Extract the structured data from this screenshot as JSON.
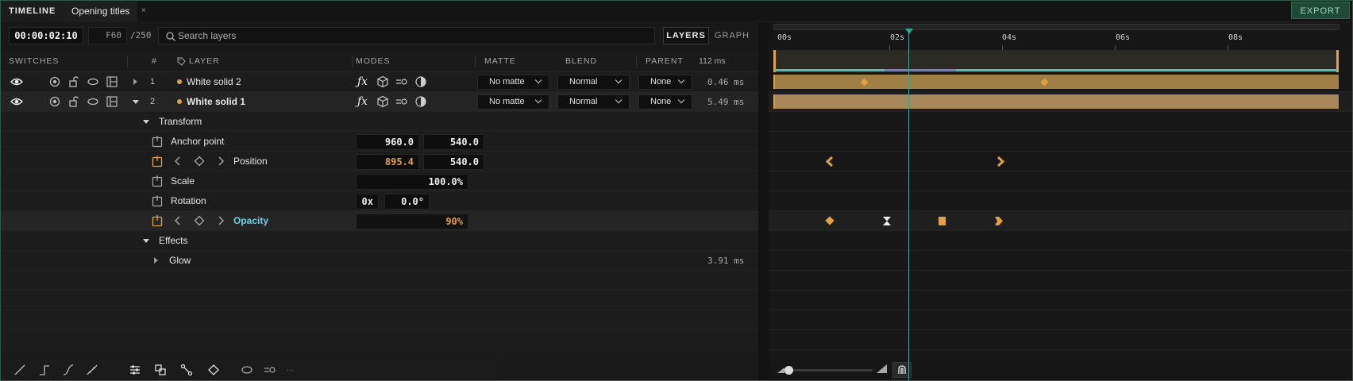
{
  "tabs": {
    "timeline": "TIMELINE",
    "document": "Opening titles",
    "close": "×"
  },
  "export_label": "EXPORT",
  "controls": {
    "timecode": "00:00:02:10",
    "frame": "F60",
    "frame_total": "/250",
    "search_placeholder": "Search layers",
    "layers_label": "LAYERS",
    "graph_label": "GRAPH"
  },
  "columns": {
    "switches": "SWITCHES",
    "number": "#",
    "layer": "LAYER",
    "modes": "MODES",
    "matte": "MATTE",
    "blend": "BLEND",
    "parent": "PARENT",
    "timing": "112 ms"
  },
  "layers": [
    {
      "number": "1",
      "name": "White solid 2",
      "matte": "No matte",
      "blend": "Normal",
      "parent": "None",
      "ms": "0.46 ms"
    },
    {
      "number": "2",
      "name": "White solid 1",
      "matte": "No matte",
      "blend": "Normal",
      "parent": "None",
      "ms": "5.49 ms"
    }
  ],
  "transform": {
    "group_label": "Transform",
    "anchor": {
      "label": "Anchor point",
      "x": "960.0",
      "y": "540.0"
    },
    "position": {
      "label": "Position",
      "x": "895.4",
      "y": "540.0"
    },
    "scale": {
      "label": "Scale",
      "value": "100.0%"
    },
    "rotation": {
      "label": "Rotation",
      "turns": "0x",
      "degrees": "0.0°"
    },
    "opacity": {
      "label": "Opacity",
      "value": "90%"
    }
  },
  "effects": {
    "group_label": "Effects",
    "glow": {
      "label": "Glow",
      "ms": "3.91 ms"
    }
  },
  "ruler": {
    "t0": "00s",
    "t2": "02s",
    "t4": "04s",
    "t6": "06s",
    "t8": "08s"
  },
  "more_label": "...",
  "colors": {
    "accent": "#e0a241",
    "playhead": "#3aa58a",
    "work_line": "#4fc3b0",
    "export_bg": "#1f4a38"
  }
}
